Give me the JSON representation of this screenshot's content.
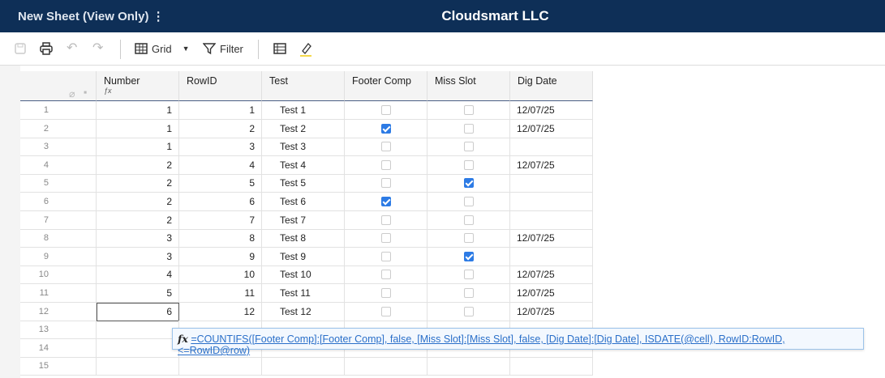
{
  "header": {
    "title": "New Sheet (View Only)",
    "menu_icon": "kebab-icon",
    "company": "Cloudsmart LLC"
  },
  "toolbar": {
    "grid_label": "Grid",
    "filter_label": "Filter"
  },
  "columns": [
    "Number",
    "RowID",
    "Test",
    "Footer Comp",
    "Miss Slot",
    "Dig Date"
  ],
  "formula_icon": "fx",
  "rows": [
    {
      "n": "1",
      "number": "1",
      "rowid": "1",
      "test": "Test 1",
      "footer": false,
      "miss": false,
      "date": "12/07/25"
    },
    {
      "n": "2",
      "number": "1",
      "rowid": "2",
      "test": "Test 2",
      "footer": true,
      "miss": false,
      "date": "12/07/25"
    },
    {
      "n": "3",
      "number": "1",
      "rowid": "3",
      "test": "Test 3",
      "footer": false,
      "miss": false,
      "date": ""
    },
    {
      "n": "4",
      "number": "2",
      "rowid": "4",
      "test": "Test 4",
      "footer": false,
      "miss": false,
      "date": "12/07/25"
    },
    {
      "n": "5",
      "number": "2",
      "rowid": "5",
      "test": "Test 5",
      "footer": false,
      "miss": true,
      "date": ""
    },
    {
      "n": "6",
      "number": "2",
      "rowid": "6",
      "test": "Test 6",
      "footer": true,
      "miss": false,
      "date": ""
    },
    {
      "n": "7",
      "number": "2",
      "rowid": "7",
      "test": "Test 7",
      "footer": false,
      "miss": false,
      "date": ""
    },
    {
      "n": "8",
      "number": "3",
      "rowid": "8",
      "test": "Test 8",
      "footer": false,
      "miss": false,
      "date": "12/07/25"
    },
    {
      "n": "9",
      "number": "3",
      "rowid": "9",
      "test": "Test 9",
      "footer": false,
      "miss": true,
      "date": ""
    },
    {
      "n": "10",
      "number": "4",
      "rowid": "10",
      "test": "Test 10",
      "footer": false,
      "miss": false,
      "date": "12/07/25"
    },
    {
      "n": "11",
      "number": "5",
      "rowid": "11",
      "test": "Test 11",
      "footer": false,
      "miss": false,
      "date": "12/07/25"
    },
    {
      "n": "12",
      "number": "6",
      "rowid": "12",
      "test": "Test 12",
      "footer": false,
      "miss": false,
      "date": "12/07/25"
    },
    {
      "n": "13"
    },
    {
      "n": "14"
    },
    {
      "n": "15"
    }
  ],
  "formula": "=COUNTIFS([Footer Comp]:[Footer Comp], false, [Miss Slot]:[Miss Slot], false, [Dig Date]:[Dig Date], ISDATE(@cell), RowID:RowID, <=RowID@row)"
}
